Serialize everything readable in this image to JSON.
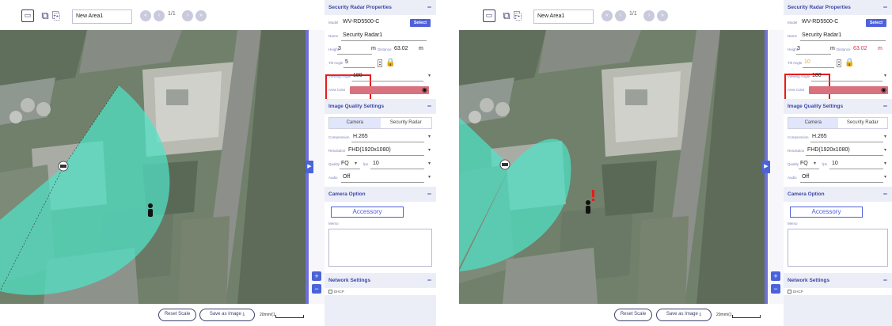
{
  "panels": [
    {
      "id": "left",
      "toolbar": {
        "area_name": "New Area1",
        "page": "1/1"
      },
      "bottom": {
        "reset_scale": "Reset Scale",
        "save_as_image": "Save as Image ⤓",
        "scale_label": "20mm/(1"
      },
      "properties": {
        "title": "Security Radar Properties",
        "model_label": "Model",
        "model_value": "WV-RD5500-C",
        "select_label": "Select",
        "name_label": "Name",
        "name_value": "Security Radar1",
        "height_label": "Height",
        "height_value": "3",
        "height_unit": "m",
        "distance_label": "Distance",
        "distance_value": "63.02",
        "distance_unit": "m",
        "tilt_label": "Tilt Angle",
        "tilt_value": "5",
        "viewing_label": "Viewing Angle",
        "viewing_value": "180",
        "area_color_label": "Area Color",
        "iq_title": "Image Quality Settings",
        "tab_camera": "Camera",
        "tab_radar": "Security Radar",
        "compression_label": "Compression",
        "compression_value": "H.265",
        "resolution_label": "Resolution",
        "resolution_value": "FHD(1920x1080)",
        "quality_label": "Quality",
        "quality_value": "FQ",
        "fps_label": "fps",
        "fps_value": "10",
        "audio_label": "Audio",
        "audio_value": "Off",
        "option_title": "Camera Option",
        "accessory_label": "Accessory",
        "memo_label": "Memo",
        "network_title": "Network Settings",
        "dhcp_label": "DHCP"
      }
    },
    {
      "id": "right",
      "toolbar": {
        "area_name": "New Area1",
        "page": "1/1"
      },
      "bottom": {
        "reset_scale": "Reset Scale",
        "save_as_image": "Save as Image ⤓",
        "scale_label": "20mm/(1"
      },
      "properties": {
        "title": "Security Radar Properties",
        "model_label": "Model",
        "model_value": "WV-RD5500-C",
        "select_label": "Select",
        "name_label": "Name",
        "name_value": "Security Radar1",
        "height_label": "Height",
        "height_value": "3",
        "height_unit": "m",
        "distance_label": "Distance",
        "distance_value": "63.02",
        "distance_unit": "m",
        "tilt_label": "Tilt Angle",
        "tilt_value": "10",
        "viewing_label": "Viewing Angle",
        "viewing_value": "180",
        "area_color_label": "Area Color",
        "iq_title": "Image Quality Settings",
        "tab_camera": "Camera",
        "tab_radar": "Security Radar",
        "compression_label": "Compression",
        "compression_value": "H.265",
        "resolution_label": "Resolution",
        "resolution_value": "FHD(1920x1080)",
        "quality_label": "Quality",
        "quality_value": "FQ",
        "fps_label": "fps",
        "fps_value": "10",
        "audio_label": "Audio",
        "audio_value": "Off",
        "option_title": "Camera Option",
        "accessory_label": "Accessory",
        "memo_label": "Memo",
        "network_title": "Network Settings",
        "dhcp_label": "DHCP"
      }
    }
  ],
  "colors": {
    "accent": "#5062d8",
    "coverage": "#4fe3c8",
    "area_color": "#d9727f",
    "highlight": "#e41b1b",
    "warning": "#d3344d"
  },
  "icons": [
    "layout-icon",
    "copy-icon",
    "chevron-left-icon",
    "chevron-right-icon",
    "lock-icon",
    "person-icon",
    "radar-device-icon",
    "color-picker-icon",
    "expand-panel-icon",
    "zoom-in-icon",
    "zoom-out-icon",
    "download-icon"
  ]
}
